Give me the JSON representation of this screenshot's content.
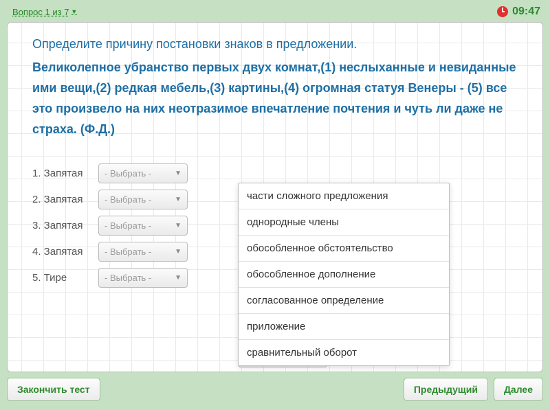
{
  "topbar": {
    "question_nav": "Вопрос 1 из 7",
    "timer": "09:47"
  },
  "instruction": "Определите причину постановки знаков в предложении.",
  "sentence": "Великолепное убранство первых двух комнат,(1) неслыханные и невиданные ими вещи,(2) редкая мебель,(3) картины,(4) огромная статуя Венеры - (5) все это произвело на них неотразимое впечатление почтения и чуть ли даже не страха. (Ф.Д.)",
  "answers": [
    {
      "label": "1. Запятая",
      "placeholder": "- Выбрать -"
    },
    {
      "label": "2. Запятая",
      "placeholder": "- Выбрать -"
    },
    {
      "label": "3. Запятая",
      "placeholder": "- Выбрать -"
    },
    {
      "label": "4. Запятая",
      "placeholder": "- Выбрать -"
    },
    {
      "label": "5. Тире",
      "placeholder": "- Выбрать -"
    }
  ],
  "ghost_placeholder": "- Выбрать -",
  "dropdown": [
    "части сложного предложения",
    "однородные члены",
    "обособленное обстоятельство",
    "обособленное дополнение",
    "согласованное определение",
    "приложение",
    "сравнительный оборот"
  ],
  "buttons": {
    "finish": "Закончить тест",
    "prev": "Предыдущий",
    "next": "Далее"
  }
}
